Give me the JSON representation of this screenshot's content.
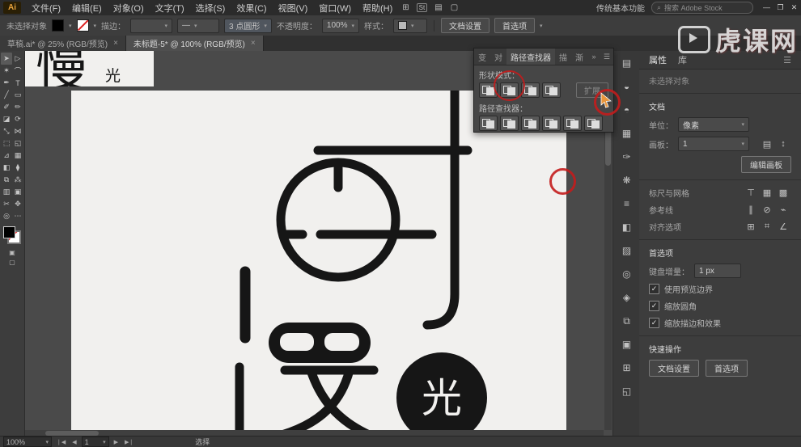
{
  "colors": {
    "annotation_red": "#c31c1c",
    "cursor_orange": "#e8963c",
    "artboard_white": "#f1f0ee",
    "ui_dark": "#3d3d3d"
  },
  "glyphs": {
    "caret_down": "▾",
    "more": "»",
    "menu": "☰",
    "check": "✓",
    "search": "⌕"
  },
  "menubar": {
    "logo": "Ai",
    "items": [
      "文件(F)",
      "编辑(E)",
      "对象(O)",
      "文字(T)",
      "选择(S)",
      "效果(C)",
      "视图(V)",
      "窗口(W)",
      "帮助(H)"
    ],
    "icons": {
      "arrange": "⊞",
      "stock": "St",
      "layout": "▤",
      "gpu": "▢"
    },
    "workspace": "传统基本功能",
    "search": "搜索 Adobe Stock",
    "win": {
      "min": "—",
      "restore": "❐",
      "close": "✕"
    }
  },
  "controlbar": {
    "no_selection": "未选择对象",
    "stroke_label": "描边：",
    "profile": "—",
    "brush": "3 点圆形",
    "opacity_label": "不透明度：",
    "opacity_value": "100%",
    "style_label": "样式：",
    "doc_setup": "文档设置",
    "preferences": "首选项"
  },
  "tabs": {
    "tab1": "草稿.ai* @ 25% (RGB/预览)",
    "tab2": "未标题-5* @ 100% (RGB/预览)",
    "close": "×"
  },
  "toolbar": {
    "tools": [
      {
        "name": "selection",
        "glyph": "➤"
      },
      {
        "name": "direct-selection",
        "glyph": "▷"
      },
      {
        "name": "magic-wand",
        "glyph": "✶"
      },
      {
        "name": "lasso",
        "glyph": "⌒"
      },
      {
        "name": "pen",
        "glyph": "✒"
      },
      {
        "name": "type",
        "glyph": "T"
      },
      {
        "name": "line",
        "glyph": "╱"
      },
      {
        "name": "rectangle",
        "glyph": "▭"
      },
      {
        "name": "paintbrush",
        "glyph": "✐"
      },
      {
        "name": "pencil",
        "glyph": "✏"
      },
      {
        "name": "eraser",
        "glyph": "◪"
      },
      {
        "name": "rotate",
        "glyph": "⟳"
      },
      {
        "name": "scale",
        "glyph": "⤡"
      },
      {
        "name": "width",
        "glyph": "⋈"
      },
      {
        "name": "free-transform",
        "glyph": "⬚"
      },
      {
        "name": "shape-builder",
        "glyph": "◱"
      },
      {
        "name": "perspective-grid",
        "glyph": "⊿"
      },
      {
        "name": "mesh",
        "glyph": "▦"
      },
      {
        "name": "gradient",
        "glyph": "◧"
      },
      {
        "name": "eyedropper",
        "glyph": "⧫"
      },
      {
        "name": "blend",
        "glyph": "⧉"
      },
      {
        "name": "symbol-sprayer",
        "glyph": "⁂"
      },
      {
        "name": "graph",
        "glyph": "▥"
      },
      {
        "name": "artboard",
        "glyph": "▣"
      },
      {
        "name": "slice",
        "glyph": "✂"
      },
      {
        "name": "hand",
        "glyph": "✥"
      },
      {
        "name": "zoom",
        "glyph": "◎"
      },
      {
        "name": "edit-toolbar",
        "glyph": "⋯"
      }
    ],
    "bottom": [
      "▣",
      "▢"
    ]
  },
  "canvas": {
    "corner_char": "慢",
    "corner_char_small": "光",
    "circle_char": "光"
  },
  "pathfinder": {
    "tabs": [
      "变",
      "对",
      "路径查找器",
      "描",
      "渐"
    ],
    "shape_mode_label": "形状模式：",
    "expand": "扩展",
    "pathfinder_label": "路径查找器："
  },
  "dock": {
    "icons": [
      {
        "name": "libraries",
        "glyph": "▤"
      },
      {
        "name": "color",
        "glyph": "◒"
      },
      {
        "name": "color-guide",
        "glyph": "◓"
      },
      {
        "name": "swatches",
        "glyph": "▦"
      },
      {
        "name": "brushes",
        "glyph": "✑"
      },
      {
        "name": "symbols",
        "glyph": "❋"
      },
      {
        "name": "stroke",
        "glyph": "≡"
      },
      {
        "name": "gradient",
        "glyph": "◧"
      },
      {
        "name": "transparency",
        "glyph": "▨"
      },
      {
        "name": "appearance",
        "glyph": "◎"
      },
      {
        "name": "graphic-styles",
        "glyph": "◈"
      },
      {
        "name": "layers",
        "glyph": "⧉"
      },
      {
        "name": "artboards",
        "glyph": "▣"
      },
      {
        "name": "align",
        "glyph": "⊞"
      },
      {
        "name": "pathfinder",
        "glyph": "◱"
      }
    ]
  },
  "properties": {
    "tab1": "属性",
    "tab2": "库",
    "no_selection": "未选择对象",
    "doc_title": "文档",
    "unit_label": "单位：",
    "unit_value": "像素",
    "artboard_label": "画板：",
    "artboard_value": "1",
    "artboard_icons": [
      "▤",
      "↕"
    ],
    "edit_artboard": "编辑画板",
    "rulers_label": "标尺与网格",
    "rulers_icons": [
      "⊤",
      "▦",
      "▩"
    ],
    "guides_label": "参考线",
    "guides_icons": [
      "∥",
      "⊘",
      "⌁"
    ],
    "snap_label": "对齐选项",
    "snap_icons": [
      "⊞",
      "⌗",
      "∠"
    ],
    "pref_title": "首选项",
    "kbd_label": "键盘增量：",
    "kbd_value": "1 px",
    "checks": [
      "使用预览边界",
      "缩放圆角",
      "缩放描边和效果"
    ],
    "quick_title": "快速操作",
    "qa1": "文档设置",
    "qa2": "首选项"
  },
  "statusbar": {
    "zoom": "100%",
    "artboard": "1",
    "status": "选择",
    "nav": [
      "❘◀",
      "◀",
      "▶",
      "▶❘"
    ]
  },
  "watermark": {
    "text": "虎课网"
  }
}
